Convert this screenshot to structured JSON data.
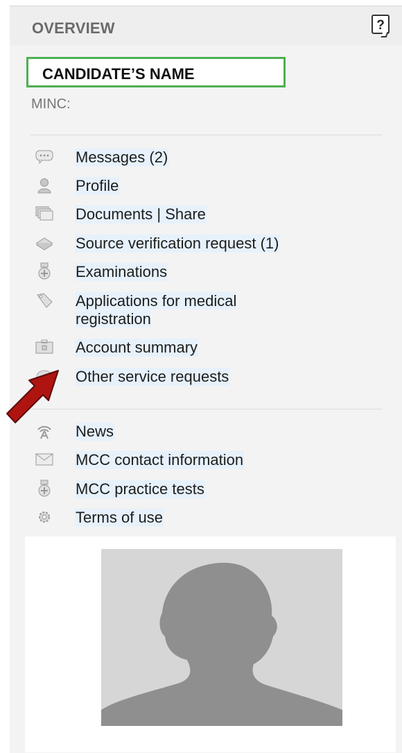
{
  "overview": {
    "title": "OVERVIEW",
    "help_label": "?"
  },
  "candidate": {
    "name": "CANDIDATE’S NAME",
    "minc_label": "MINC:"
  },
  "menu_primary": [
    {
      "label": "Messages (2)",
      "icon": "message-bubble-icon"
    },
    {
      "label": "Profile",
      "icon": "profile-user-icon"
    },
    {
      "label": "Documents | Share",
      "icon": "documents-stack-icon"
    },
    {
      "label": "Source verification request (1)",
      "icon": "source-verification-icon"
    },
    {
      "label": "Examinations",
      "icon": "examination-medal-icon"
    },
    {
      "label": "Applications for medical registration",
      "label_line1": "Applications for medical",
      "label_line2": "registration",
      "icon": "application-tag-icon"
    },
    {
      "label": "Account summary",
      "icon": "wallet-icon"
    },
    {
      "label": "Other service requests",
      "icon": "service-request-icon"
    }
  ],
  "menu_secondary": [
    {
      "label": "News",
      "icon": "news-feed-icon"
    },
    {
      "label": "MCC contact information",
      "icon": "envelope-icon"
    },
    {
      "label": "MCC practice tests",
      "icon": "practice-test-medal-icon"
    },
    {
      "label": "Terms of use",
      "icon": "gear-icon"
    }
  ],
  "colors": {
    "panel_bg": "#f3f3f3",
    "name_box_border": "#4caf50",
    "link_highlight": "#e6f1fb",
    "arrow": "#b01410",
    "avatar_bg": "#d6d6d6",
    "avatar_silhouette": "#8f8f8f"
  }
}
